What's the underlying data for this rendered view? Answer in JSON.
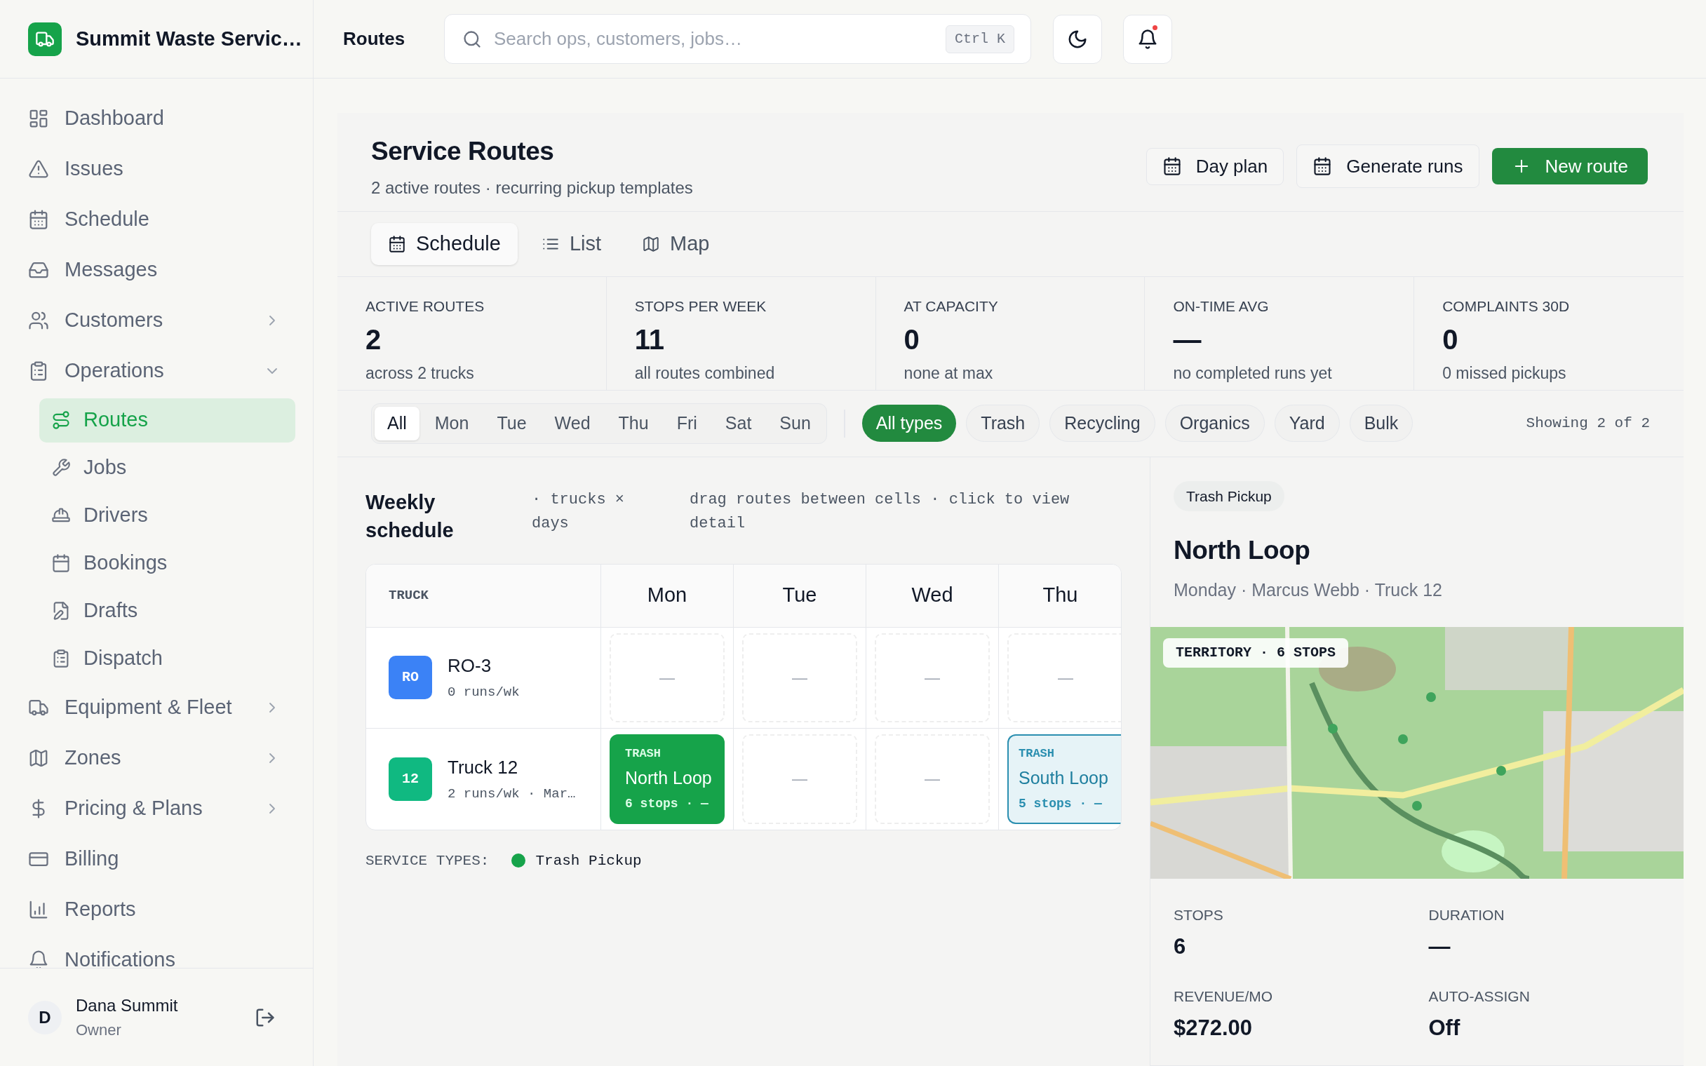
{
  "app": {
    "name": "Summit Waste Servic…"
  },
  "sidebar": {
    "items": [
      {
        "label": "Dashboard",
        "selected": false
      },
      {
        "label": "Issues",
        "selected": false
      },
      {
        "label": "Schedule",
        "selected": false
      },
      {
        "label": "Messages",
        "selected": false
      },
      {
        "label": "Customers",
        "selected": false,
        "expanded": false
      },
      {
        "label": "Operations",
        "selected": false,
        "expanded": true,
        "children": [
          {
            "label": "Routes",
            "selected": true
          },
          {
            "label": "Jobs",
            "selected": false
          },
          {
            "label": "Drivers",
            "selected": false
          },
          {
            "label": "Bookings",
            "selected": false
          },
          {
            "label": "Drafts",
            "selected": false
          },
          {
            "label": "Dispatch",
            "selected": false
          }
        ]
      },
      {
        "label": "Equipment & Fleet",
        "selected": false,
        "expanded": false
      },
      {
        "label": "Zones",
        "selected": false,
        "expanded": false
      },
      {
        "label": "Pricing & Plans",
        "selected": false,
        "expanded": false
      },
      {
        "label": "Billing",
        "selected": false
      },
      {
        "label": "Reports",
        "selected": false
      },
      {
        "label": "Notifications",
        "selected": false
      }
    ]
  },
  "user": {
    "initial": "D",
    "name": "Dana Summit",
    "role": "Owner"
  },
  "topbar": {
    "breadcrumb": "Routes",
    "search": {
      "placeholder": "Search ops, customers, jobs…",
      "shortcut": "Ctrl K"
    },
    "notifications_unread": true
  },
  "header": {
    "title": "Service Routes",
    "subtitle": "2 active routes · recurring pickup templates",
    "buttons": [
      {
        "label": "Day plan",
        "kind": "outline"
      },
      {
        "label": "Generate runs",
        "kind": "outline"
      },
      {
        "label": "New route",
        "kind": "primary"
      }
    ]
  },
  "view_tabs": [
    {
      "label": "Schedule",
      "selected": true
    },
    {
      "label": "List",
      "selected": false
    },
    {
      "label": "Map",
      "selected": false
    }
  ],
  "stats": [
    {
      "label": "ACTIVE ROUTES",
      "value": "2",
      "note": "across 2 trucks"
    },
    {
      "label": "STOPS PER WEEK",
      "value": "11",
      "note": "all routes combined"
    },
    {
      "label": "AT CAPACITY",
      "value": "0",
      "note": "none at max"
    },
    {
      "label": "ON-TIME AVG",
      "value": "—",
      "note": "no completed runs yet"
    },
    {
      "label": "COMPLAINTS 30D",
      "value": "0",
      "note": "0 missed pickups"
    }
  ],
  "day_filter": [
    {
      "label": "All",
      "selected": true
    },
    {
      "label": "Mon",
      "selected": false
    },
    {
      "label": "Tue",
      "selected": false
    },
    {
      "label": "Wed",
      "selected": false
    },
    {
      "label": "Thu",
      "selected": false
    },
    {
      "label": "Fri",
      "selected": false
    },
    {
      "label": "Sat",
      "selected": false
    },
    {
      "label": "Sun",
      "selected": false
    }
  ],
  "type_filter": [
    {
      "label": "All types",
      "selected": true
    },
    {
      "label": "Trash",
      "selected": false
    },
    {
      "label": "Recycling",
      "selected": false
    },
    {
      "label": "Organics",
      "selected": false
    },
    {
      "label": "Yard",
      "selected": false
    },
    {
      "label": "Bulk",
      "selected": false
    }
  ],
  "showing": "Showing 2 of 2",
  "schedule": {
    "title": "Weekly schedule",
    "note": "· trucks × days",
    "hint": "drag routes between cells · click to view detail",
    "columns": [
      "TRUCK",
      "Mon",
      "Tue",
      "Wed",
      "Thu"
    ],
    "rows": [
      {
        "cells": [
          {
            "kind": "truck",
            "badge": "RO",
            "color": "#3b82f6",
            "name": "RO-3",
            "meta": "0 runs/wk"
          },
          {
            "kind": "empty",
            "text": "—"
          },
          {
            "kind": "empty",
            "text": "—"
          },
          {
            "kind": "empty",
            "text": "—"
          },
          {
            "kind": "empty",
            "text": "—"
          }
        ]
      },
      {
        "cells": [
          {
            "kind": "truck",
            "badge": "12",
            "color": "#10b981",
            "name": "Truck 12",
            "meta": "2 runs/wk · Mar…"
          },
          {
            "kind": "route",
            "type": "TRASH",
            "name": "North Loop",
            "meta": "6 stops · —",
            "selected": true
          },
          {
            "kind": "empty",
            "text": "—"
          },
          {
            "kind": "empty",
            "text": "—"
          },
          {
            "kind": "route",
            "type": "TRASH",
            "name": "South Loop",
            "meta": "5 stops · —",
            "selected": false
          }
        ]
      }
    ],
    "legend_label": "SERVICE TYPES:",
    "legend": [
      {
        "label": "Trash Pickup",
        "color": "#16a34a"
      }
    ]
  },
  "detail": {
    "tag": "Trash Pickup",
    "title": "North Loop",
    "subtitle": "Monday · Marcus Webb · Truck 12",
    "map": {
      "kind": "picture",
      "badge": "TERRITORY · 6 STOPS"
    },
    "fields": [
      {
        "label": "STOPS",
        "value": "6"
      },
      {
        "label": "DURATION",
        "value": "—"
      },
      {
        "label": "REVENUE/MO",
        "value": "$272.00"
      },
      {
        "label": "AUTO-ASSIGN",
        "value": "Off"
      }
    ]
  }
}
